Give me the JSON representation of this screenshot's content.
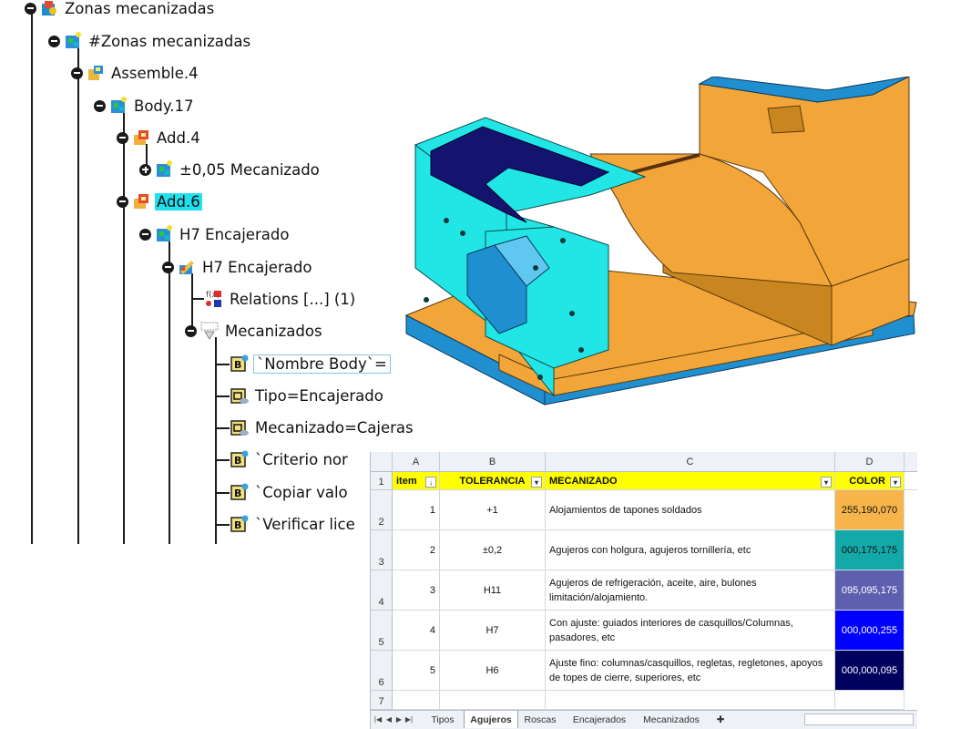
{
  "tree": {
    "nodes": [
      {
        "label": "Zonas mecanizadas",
        "icon": "product-icon"
      },
      {
        "label": "#Zonas mecanizadas",
        "icon": "part-body-icon"
      },
      {
        "label": "Assemble.4",
        "icon": "assemble-icon"
      },
      {
        "label": "Body.17",
        "icon": "part-body-icon"
      },
      {
        "label": "Add.4",
        "icon": "add-operation-icon"
      },
      {
        "label": "±0,05 Mecanizado",
        "icon": "part-body-icon"
      },
      {
        "label": "Add.6",
        "icon": "add-operation-icon"
      },
      {
        "label": "H7 Encajerado",
        "icon": "part-body-icon"
      },
      {
        "label": "H7 Encajerado",
        "icon": "user-feature-icon"
      },
      {
        "label": "Relations [...] (1)",
        "icon": "relations-icon"
      },
      {
        "label": "Mecanizados",
        "icon": "parameters-icon"
      },
      {
        "label": "`Nombre Body`=",
        "icon": "boolean-parameter-icon"
      },
      {
        "label": "Tipo=Encajerado",
        "icon": "string-parameter-icon"
      },
      {
        "label": "Mecanizado=Cajeras",
        "icon": "string-parameter-icon"
      },
      {
        "label": "`Criterio nor",
        "icon": "boolean-parameter-icon"
      },
      {
        "label": "`Copiar valo",
        "icon": "boolean-parameter-icon"
      },
      {
        "label": "`Verificar lice",
        "icon": "boolean-parameter-icon"
      }
    ]
  },
  "sheet": {
    "columns": [
      "A",
      "B",
      "C",
      "D"
    ],
    "rows": [
      "1",
      "2",
      "3",
      "4",
      "5",
      "6",
      "7"
    ],
    "headers": {
      "item": "item",
      "tolerancia": "TOLERANCIA",
      "mecanizado": "MECANIZADO",
      "color": "COLOR"
    },
    "data": [
      {
        "item": "1",
        "tolerancia": "+1",
        "mecanizado": "Alojamientos de tapones soldados",
        "color": "255,190,070",
        "bg": "#f6b44a",
        "fg": "#111111"
      },
      {
        "item": "2",
        "tolerancia": "±0,2",
        "mecanizado": "Agujeros con holgura, agujeros tornillería, etc",
        "color": "000,175,175",
        "bg": "#13a9a9",
        "fg": "#111111"
      },
      {
        "item": "3",
        "tolerancia": "H11",
        "mecanizado": "Agujeros de refrigeración, aceite, aire, bulones limitación/alojamiento.",
        "color": "095,095,175",
        "bg": "#5f5faf",
        "fg": "#ffffff"
      },
      {
        "item": "4",
        "tolerancia": "H7",
        "mecanizado": "Con ajuste: guiados interiores de casquillos/Columnas, pasadores, etc",
        "color": "000,000,255",
        "bg": "#0000ff",
        "fg": "#ffffff"
      },
      {
        "item": "5",
        "tolerancia": "H6",
        "mecanizado": "Ajuste fino: columnas/casquillos, regletas, regletones, apoyos de topes de cierre, superiores, etc",
        "color": "000,000,095",
        "bg": "#00005f",
        "fg": "#ffffff"
      }
    ],
    "tabs": [
      "Tipos",
      "Agujeros",
      "Roscas",
      "Encajerados",
      "Mecanizados"
    ],
    "active_tab": "Agujeros"
  },
  "colors": {
    "part_orange": "#f2a63a",
    "part_cyan": "#22e6e6",
    "part_blue": "#1f8fd0",
    "part_navy": "#14146e",
    "selection": "#20e0f0"
  }
}
